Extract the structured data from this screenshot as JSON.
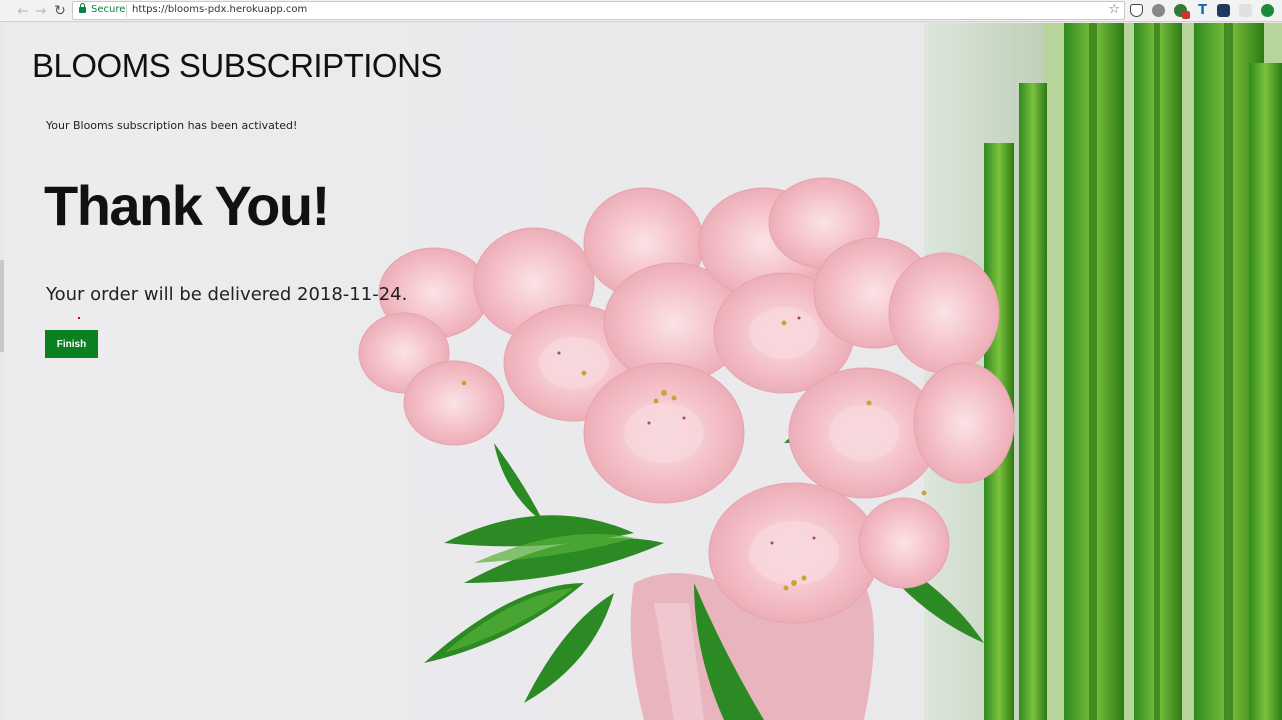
{
  "browser": {
    "secure_label": "Secure",
    "url": "https://blooms-pdx.herokuapp.com"
  },
  "page": {
    "title": "BLOOMS SUBSCRIPTIONS",
    "activated_message": "Your Blooms subscription has been activated!",
    "thank_you": "Thank You!",
    "delivery_prefix": "Your order will be delivered ",
    "delivery_date": "2018-11-24",
    "delivery_suffix": ".",
    "finish_label": "Finish"
  },
  "colors": {
    "accent": "#0b8021",
    "secure": "#0b8043"
  },
  "icons": {
    "back": "back-arrow-icon",
    "forward": "forward-arrow-icon",
    "reload": "reload-icon",
    "lock": "lock-icon",
    "bookmark": "star-icon"
  }
}
